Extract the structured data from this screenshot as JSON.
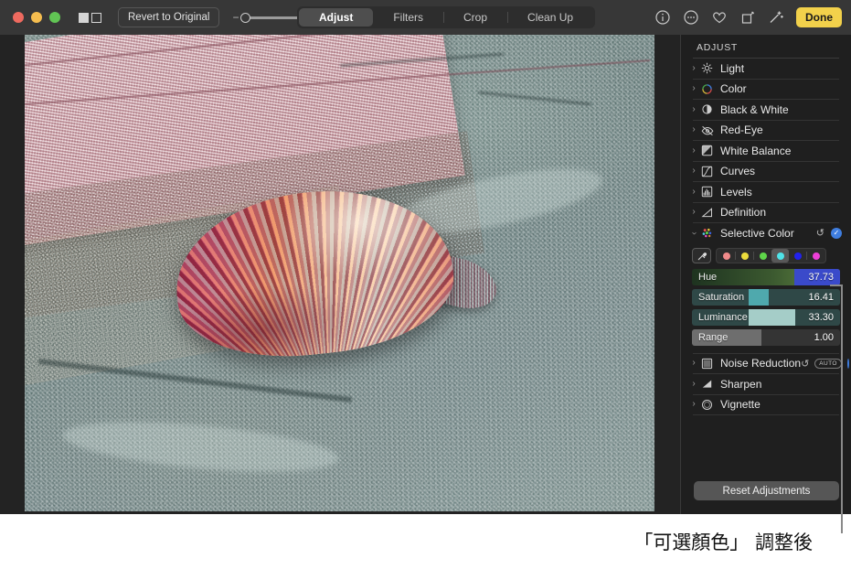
{
  "window": {
    "traffic_lights": [
      "close",
      "minimize",
      "zoom"
    ]
  },
  "toolbar": {
    "compare_icon": "split-view-icon",
    "revert_label": "Revert to Original",
    "zoom_minus": "−",
    "zoom_plus": "+",
    "tabs": [
      {
        "label": "Adjust",
        "active": true
      },
      {
        "label": "Filters",
        "active": false
      },
      {
        "label": "Crop",
        "active": false
      },
      {
        "label": "Clean Up",
        "active": false
      }
    ],
    "right_icons": [
      "info-icon",
      "more-icon",
      "favorite-icon",
      "rotate-icon",
      "auto-enhance-icon"
    ],
    "done_label": "Done"
  },
  "sidebar": {
    "title": "ADJUST",
    "items": [
      {
        "label": "Light",
        "icon": "light-icon",
        "expanded": false
      },
      {
        "label": "Color",
        "icon": "color-icon",
        "expanded": false
      },
      {
        "label": "Black & White",
        "icon": "black-white-icon",
        "expanded": false
      },
      {
        "label": "Red-Eye",
        "icon": "red-eye-icon",
        "expanded": false
      },
      {
        "label": "White Balance",
        "icon": "white-balance-icon",
        "expanded": false
      },
      {
        "label": "Curves",
        "icon": "curves-icon",
        "expanded": false
      },
      {
        "label": "Levels",
        "icon": "levels-icon",
        "expanded": false
      },
      {
        "label": "Definition",
        "icon": "definition-icon",
        "expanded": false
      }
    ],
    "selective_color": {
      "label": "Selective Color",
      "icon": "selective-color-icon",
      "expanded": true,
      "revert_icon": "revert-icon",
      "enabled_check": "✓",
      "eyedropper_icon": "eyedropper-icon",
      "swatches": [
        {
          "name": "red",
          "color": "#f08a8a",
          "selected": false
        },
        {
          "name": "yellow",
          "color": "#ecdc3c",
          "selected": false
        },
        {
          "name": "green",
          "color": "#5fd64a",
          "selected": false
        },
        {
          "name": "cyan",
          "color": "#4fe3e8",
          "selected": true
        },
        {
          "name": "blue",
          "color": "#2222ee",
          "selected": false
        },
        {
          "name": "magenta",
          "color": "#ee3fd8",
          "selected": false
        }
      ],
      "sliders": [
        {
          "label": "Hue",
          "value": "37.73",
          "fill_pct": 69,
          "fill_color": "#3a4aca",
          "track_color": "#2d4433"
        },
        {
          "label": "Saturation",
          "value": "16.41",
          "fill_pct": 38,
          "fill_color": "#4fa9ad",
          "track_color": "#2f4847"
        },
        {
          "label": "Luminance",
          "value": "33.30",
          "fill_pct": 62,
          "fill_color": "#a5cdc8",
          "track_color": "#2f4847"
        },
        {
          "label": "Range",
          "value": "1.00",
          "fill_pct": 47,
          "fill_color": "#6e6e6e",
          "track_color": "#3a3a3a"
        }
      ]
    },
    "items_after": [
      {
        "label": "Noise Reduction",
        "icon": "noise-reduction-icon",
        "revert_icon": "revert-icon",
        "auto_label": "AUTO",
        "toggle": "off"
      },
      {
        "label": "Sharpen",
        "icon": "sharpen-icon"
      },
      {
        "label": "Vignette",
        "icon": "vignette-icon"
      }
    ],
    "reset_label": "Reset Adjustments"
  },
  "caption": {
    "text": "「可選顏色」 調整後"
  },
  "colors": {
    "accent_blue": "#3f7ee0",
    "done_yellow": "#f2d14b",
    "toolbar_bg": "#373737",
    "sidebar_bg": "#1f1f1f",
    "canvas_bg": "#232323"
  }
}
